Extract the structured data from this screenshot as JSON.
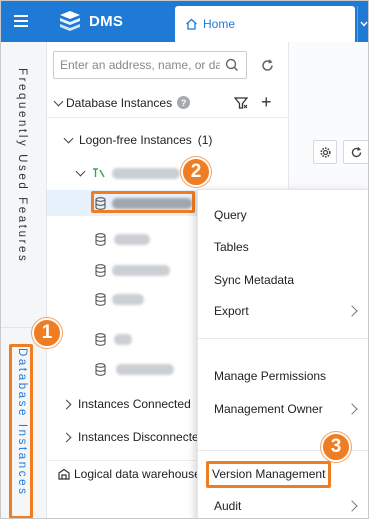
{
  "topbar": {
    "brand": "DMS",
    "home_tab": "Home",
    "colors": {
      "bar": "#1f7ad6",
      "accent": "#ef7d22"
    }
  },
  "rail": {
    "frequently_used": "Frequently Used Features",
    "database_instances": "Database Instances"
  },
  "search": {
    "placeholder": "Enter an address, name, or dat"
  },
  "tree": {
    "header_title": "Database Instances",
    "help_glyph": "?",
    "add_glyph": "+",
    "logon_free": "Logon-free Instances",
    "logon_free_count": "(1)",
    "connected": "Instances Connected",
    "disconnected": "Instances Disconnecte",
    "logical_dw": "Logical data warehouse"
  },
  "context_menu": {
    "query": "Query",
    "tables": "Tables",
    "sync_metadata": "Sync Metadata",
    "export": "Export",
    "manage_permissions": "Manage Permissions",
    "management_owner": "Management Owner",
    "version_management": "Version Management",
    "audit": "Audit"
  },
  "badges": {
    "one": "1",
    "two": "2",
    "three": "3"
  }
}
